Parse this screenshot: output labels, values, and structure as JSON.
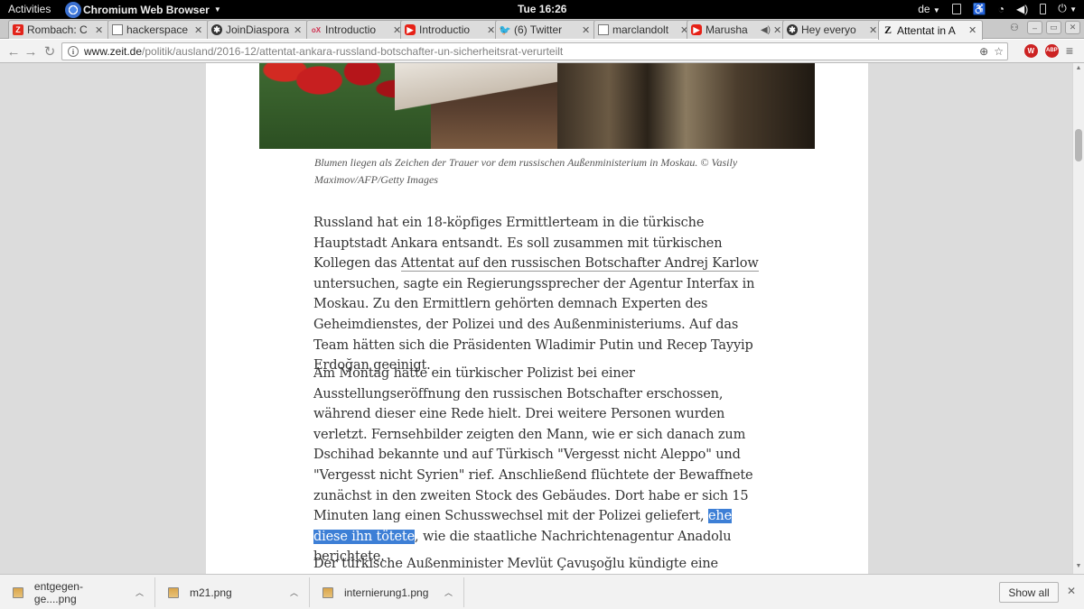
{
  "topbar": {
    "activities": "Activities",
    "app_name": "Chromium Web Browser",
    "clock": "Tue 16:26",
    "keyboard_layout": "de"
  },
  "tabs": [
    {
      "title": "Rombach: C",
      "favicon": "zeit-red-icon"
    },
    {
      "title": "hackerspace",
      "favicon": "page-icon"
    },
    {
      "title": "JoinDiaspora",
      "favicon": "diaspora-icon"
    },
    {
      "title": "Introductio",
      "favicon": "ox-icon"
    },
    {
      "title": "Introductio",
      "favicon": "youtube-icon"
    },
    {
      "title": "(6) Twitter",
      "favicon": "twitter-icon"
    },
    {
      "title": "marclandolt",
      "favicon": "page-icon"
    },
    {
      "title": "Marusha",
      "favicon": "youtube-icon"
    },
    {
      "title": "Hey everyo",
      "favicon": "diaspora-icon"
    },
    {
      "title": "Attentat in A",
      "favicon": "zeit-icon",
      "active": true
    }
  ],
  "address_bar": {
    "url_host": "www.zeit.de",
    "url_path": "/politik/ausland/2016-12/attentat-ankara-russland-botschafter-un-sicherheitsrat-verurteilt"
  },
  "article": {
    "caption": "Blumen liegen als Zeichen der Trauer vor dem russischen Außenministerium in Moskau. © Vasily Maximov/AFP/Getty Images",
    "p1": {
      "before": "Russland hat ein 18-köpfiges Ermittlerteam in die türkische Hauptstadt Ankara entsandt. Es soll zusammen mit türkischen Kollegen das ",
      "link": "Attentat auf den russischen Botschafter Andrej Karlow",
      "after": " untersuchen, sagte ein Regierungssprecher der Agentur Interfax in Moskau. Zu den Ermittlern gehörten demnach Experten des Geheimdienstes, der Polizei und des Außenministeriums. Auf das Team hätten sich die Präsidenten Wladimir Putin und Recep Tayyip Erdoğan geeinigt."
    },
    "p2": {
      "before": "Am Montag hatte ein türkischer Polizist bei einer Ausstellungseröffnung den russischen Botschafter erschossen, während dieser eine Rede hielt. Drei weitere Personen wurden verletzt. Fernsehbilder zeigten den Mann, wie er sich danach zum Dschihad bekannte und auf Türkisch \"Vergesst nicht Aleppo\" und \"Vergesst nicht Syrien\" rief. Anschließend flüchtete der Bewaffnete zunächst in den zweiten Stock des Gebäudes. Dort habe er sich 15 Minuten lang einen Schusswechsel mit der Polizei geliefert, ",
      "highlighted": "ehe diese ihn tötete",
      "after": ", wie die staatliche Nachrichtenagentur Anadolu berichtete."
    },
    "p3": "Der türkische Außenminister Mevlüt Çavuşoğlu kündigte eine"
  },
  "downloads": {
    "items": [
      "entgegen-ge....png",
      "m21.png",
      "internierung1.png"
    ],
    "show_all": "Show all"
  },
  "colors": {
    "selection": "#3d7fd6",
    "page_bg": "#dcdcdc",
    "text": "#333333"
  }
}
